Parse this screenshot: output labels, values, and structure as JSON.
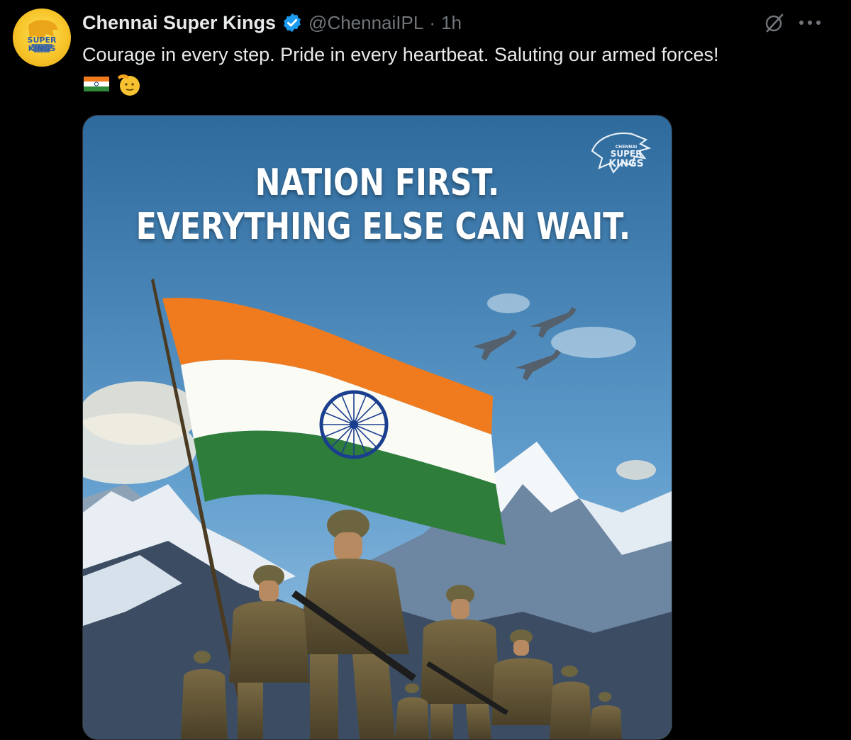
{
  "tweet": {
    "author_name": "Chennai Super Kings",
    "handle": "@ChennaiIPL",
    "separator": "·",
    "time": "1h",
    "text": "Courage in every step. Pride in every heartbeat. Saluting our armed forces!",
    "emojis": [
      "indian-flag",
      "saluting-face"
    ],
    "avatar_logo_text": [
      "SUPER",
      "KINGS"
    ]
  },
  "media": {
    "headline_line1": "NATION FIRST.",
    "headline_line2": "EVERYTHING ELSE CAN WAIT.",
    "logo_text": [
      "CHENNAI",
      "SUPER",
      "KINGS"
    ]
  },
  "icons": {
    "verified": "verified-badge-icon",
    "grok": "grok-icon",
    "more": "more-options-icon"
  },
  "colors": {
    "background": "#000000",
    "text_primary": "#e7e9ea",
    "text_secondary": "#71767b",
    "verified_blue": "#1d9bf0",
    "saffron": "#f07a1c",
    "india_green": "#2f7d3a",
    "chakra_blue": "#1b3f8f"
  }
}
